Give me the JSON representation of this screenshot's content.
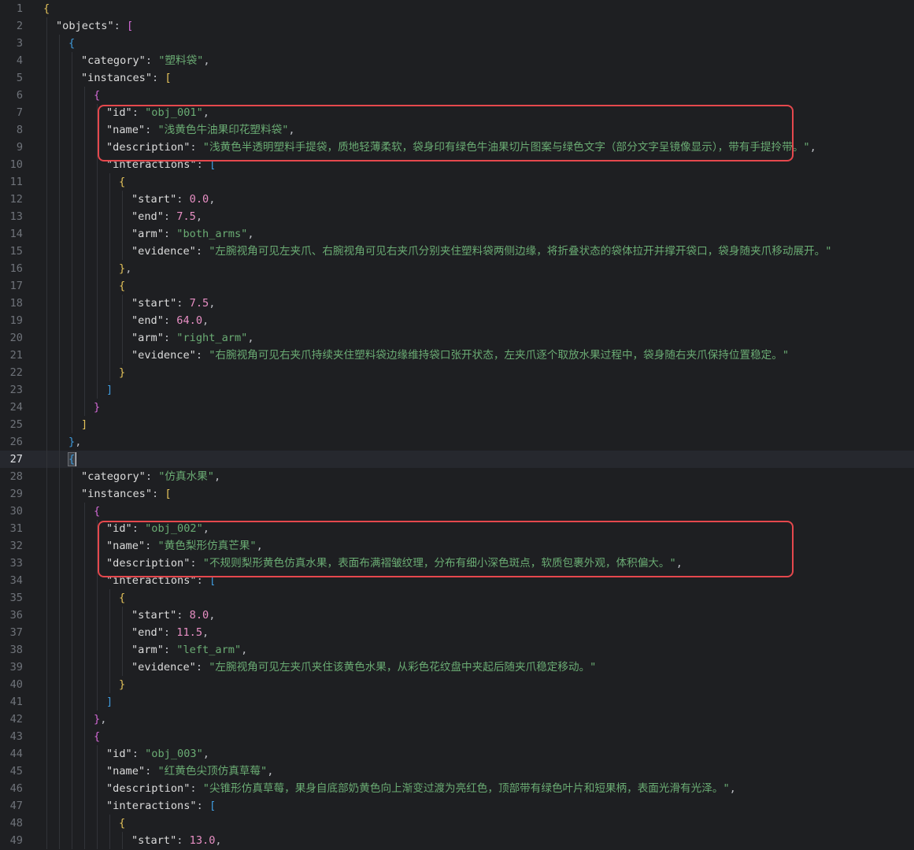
{
  "editor": {
    "current_line": 27,
    "highlight_boxes": [
      {
        "name": "highlight-obj-001",
        "from_line": 7,
        "to_line": 9
      },
      {
        "name": "highlight-obj-002",
        "from_line": 31,
        "to_line": 33
      }
    ],
    "lines": [
      {
        "n": "1",
        "indent": 0,
        "t": [
          [
            "b1",
            "{"
          ]
        ]
      },
      {
        "n": "2",
        "indent": 1,
        "t": [
          [
            "key",
            "\"objects\""
          ],
          [
            "punc",
            ": "
          ],
          [
            "b2",
            "["
          ]
        ]
      },
      {
        "n": "3",
        "indent": 2,
        "t": [
          [
            "b3",
            "{"
          ]
        ]
      },
      {
        "n": "4",
        "indent": 3,
        "t": [
          [
            "key",
            "\"category\""
          ],
          [
            "punc",
            ": "
          ],
          [
            "str",
            "\"塑料袋\""
          ],
          [
            "punc",
            ","
          ]
        ]
      },
      {
        "n": "5",
        "indent": 3,
        "t": [
          [
            "key",
            "\"instances\""
          ],
          [
            "punc",
            ": "
          ],
          [
            "b1",
            "["
          ]
        ]
      },
      {
        "n": "6",
        "indent": 4,
        "t": [
          [
            "b2",
            "{"
          ]
        ]
      },
      {
        "n": "7",
        "indent": 5,
        "t": [
          [
            "key",
            "\"id\""
          ],
          [
            "punc",
            ": "
          ],
          [
            "str",
            "\"obj_001\""
          ],
          [
            "punc",
            ","
          ]
        ]
      },
      {
        "n": "8",
        "indent": 5,
        "t": [
          [
            "key",
            "\"name\""
          ],
          [
            "punc",
            ": "
          ],
          [
            "str",
            "\"浅黄色牛油果印花塑料袋\""
          ],
          [
            "punc",
            ","
          ]
        ]
      },
      {
        "n": "9",
        "indent": 5,
        "t": [
          [
            "key",
            "\"description\""
          ],
          [
            "punc",
            ": "
          ],
          [
            "str",
            "\"浅黄色半透明塑料手提袋，质地轻薄柔软，袋身印有绿色牛油果切片图案与绿色文字（部分文字呈镜像显示），带有手提拎带。\""
          ],
          [
            "punc",
            ","
          ]
        ]
      },
      {
        "n": "10",
        "indent": 5,
        "t": [
          [
            "key",
            "\"interactions\""
          ],
          [
            "punc",
            ": "
          ],
          [
            "b3",
            "["
          ]
        ]
      },
      {
        "n": "11",
        "indent": 6,
        "t": [
          [
            "b1",
            "{"
          ]
        ]
      },
      {
        "n": "12",
        "indent": 7,
        "t": [
          [
            "key",
            "\"start\""
          ],
          [
            "punc",
            ": "
          ],
          [
            "num",
            "0.0"
          ],
          [
            "punc",
            ","
          ]
        ]
      },
      {
        "n": "13",
        "indent": 7,
        "t": [
          [
            "key",
            "\"end\""
          ],
          [
            "punc",
            ": "
          ],
          [
            "num",
            "7.5"
          ],
          [
            "punc",
            ","
          ]
        ]
      },
      {
        "n": "14",
        "indent": 7,
        "t": [
          [
            "key",
            "\"arm\""
          ],
          [
            "punc",
            ": "
          ],
          [
            "str",
            "\"both_arms\""
          ],
          [
            "punc",
            ","
          ]
        ]
      },
      {
        "n": "15",
        "indent": 7,
        "t": [
          [
            "key",
            "\"evidence\""
          ],
          [
            "punc",
            ": "
          ],
          [
            "str",
            "\"左腕视角可见左夹爪、右腕视角可见右夹爪分别夹住塑料袋两侧边缘，将折叠状态的袋体拉开并撑开袋口，袋身随夹爪移动展开。\""
          ]
        ]
      },
      {
        "n": "16",
        "indent": 6,
        "t": [
          [
            "b1",
            "}"
          ],
          [
            "punc",
            ","
          ]
        ]
      },
      {
        "n": "17",
        "indent": 6,
        "t": [
          [
            "b1",
            "{"
          ]
        ]
      },
      {
        "n": "18",
        "indent": 7,
        "t": [
          [
            "key",
            "\"start\""
          ],
          [
            "punc",
            ": "
          ],
          [
            "num",
            "7.5"
          ],
          [
            "punc",
            ","
          ]
        ]
      },
      {
        "n": "19",
        "indent": 7,
        "t": [
          [
            "key",
            "\"end\""
          ],
          [
            "punc",
            ": "
          ],
          [
            "num",
            "64.0"
          ],
          [
            "punc",
            ","
          ]
        ]
      },
      {
        "n": "20",
        "indent": 7,
        "t": [
          [
            "key",
            "\"arm\""
          ],
          [
            "punc",
            ": "
          ],
          [
            "str",
            "\"right_arm\""
          ],
          [
            "punc",
            ","
          ]
        ]
      },
      {
        "n": "21",
        "indent": 7,
        "t": [
          [
            "key",
            "\"evidence\""
          ],
          [
            "punc",
            ": "
          ],
          [
            "str",
            "\"右腕视角可见右夹爪持续夹住塑料袋边缘维持袋口张开状态，左夹爪逐个取放水果过程中，袋身随右夹爪保持位置稳定。\""
          ]
        ]
      },
      {
        "n": "22",
        "indent": 6,
        "t": [
          [
            "b1",
            "}"
          ]
        ]
      },
      {
        "n": "23",
        "indent": 5,
        "t": [
          [
            "b3",
            "]"
          ]
        ]
      },
      {
        "n": "24",
        "indent": 4,
        "t": [
          [
            "b2",
            "}"
          ]
        ]
      },
      {
        "n": "25",
        "indent": 3,
        "t": [
          [
            "b1",
            "]"
          ]
        ]
      },
      {
        "n": "26",
        "indent": 2,
        "t": [
          [
            "b3",
            "}"
          ],
          [
            "punc",
            ","
          ]
        ]
      },
      {
        "n": "27",
        "indent": 2,
        "t": [
          [
            "b3 cursor-bracket",
            "{"
          ],
          [
            "caret",
            ""
          ]
        ]
      },
      {
        "n": "28",
        "indent": 3,
        "t": [
          [
            "key",
            "\"category\""
          ],
          [
            "punc",
            ": "
          ],
          [
            "str",
            "\"仿真水果\""
          ],
          [
            "punc",
            ","
          ]
        ]
      },
      {
        "n": "29",
        "indent": 3,
        "t": [
          [
            "key",
            "\"instances\""
          ],
          [
            "punc",
            ": "
          ],
          [
            "b1",
            "["
          ]
        ]
      },
      {
        "n": "30",
        "indent": 4,
        "t": [
          [
            "b2",
            "{"
          ]
        ]
      },
      {
        "n": "31",
        "indent": 5,
        "t": [
          [
            "key",
            "\"id\""
          ],
          [
            "punc",
            ": "
          ],
          [
            "str",
            "\"obj_002\""
          ],
          [
            "punc",
            ","
          ]
        ]
      },
      {
        "n": "32",
        "indent": 5,
        "t": [
          [
            "key",
            "\"name\""
          ],
          [
            "punc",
            ": "
          ],
          [
            "str",
            "\"黄色梨形仿真芒果\""
          ],
          [
            "punc",
            ","
          ]
        ]
      },
      {
        "n": "33",
        "indent": 5,
        "t": [
          [
            "key",
            "\"description\""
          ],
          [
            "punc",
            ": "
          ],
          [
            "str",
            "\"不规则梨形黄色仿真水果，表面布满褶皱纹理，分布有细小深色斑点，软质包裹外观，体积偏大。\""
          ],
          [
            "punc",
            ","
          ]
        ]
      },
      {
        "n": "34",
        "indent": 5,
        "t": [
          [
            "key",
            "\"interactions\""
          ],
          [
            "punc",
            ": "
          ],
          [
            "b3",
            "["
          ]
        ]
      },
      {
        "n": "35",
        "indent": 6,
        "t": [
          [
            "b1",
            "{"
          ]
        ]
      },
      {
        "n": "36",
        "indent": 7,
        "t": [
          [
            "key",
            "\"start\""
          ],
          [
            "punc",
            ": "
          ],
          [
            "num",
            "8.0"
          ],
          [
            "punc",
            ","
          ]
        ]
      },
      {
        "n": "37",
        "indent": 7,
        "t": [
          [
            "key",
            "\"end\""
          ],
          [
            "punc",
            ": "
          ],
          [
            "num",
            "11.5"
          ],
          [
            "punc",
            ","
          ]
        ]
      },
      {
        "n": "38",
        "indent": 7,
        "t": [
          [
            "key",
            "\"arm\""
          ],
          [
            "punc",
            ": "
          ],
          [
            "str",
            "\"left_arm\""
          ],
          [
            "punc",
            ","
          ]
        ]
      },
      {
        "n": "39",
        "indent": 7,
        "t": [
          [
            "key",
            "\"evidence\""
          ],
          [
            "punc",
            ": "
          ],
          [
            "str",
            "\"左腕视角可见左夹爪夹住该黄色水果，从彩色花纹盘中夹起后随夹爪稳定移动。\""
          ]
        ]
      },
      {
        "n": "40",
        "indent": 6,
        "t": [
          [
            "b1",
            "}"
          ]
        ]
      },
      {
        "n": "41",
        "indent": 5,
        "t": [
          [
            "b3",
            "]"
          ]
        ]
      },
      {
        "n": "42",
        "indent": 4,
        "t": [
          [
            "b2",
            "}"
          ],
          [
            "punc",
            ","
          ]
        ]
      },
      {
        "n": "43",
        "indent": 4,
        "t": [
          [
            "b2",
            "{"
          ]
        ]
      },
      {
        "n": "44",
        "indent": 5,
        "t": [
          [
            "key",
            "\"id\""
          ],
          [
            "punc",
            ": "
          ],
          [
            "str",
            "\"obj_003\""
          ],
          [
            "punc",
            ","
          ]
        ]
      },
      {
        "n": "45",
        "indent": 5,
        "t": [
          [
            "key",
            "\"name\""
          ],
          [
            "punc",
            ": "
          ],
          [
            "str",
            "\"红黄色尖顶仿真草莓\""
          ],
          [
            "punc",
            ","
          ]
        ]
      },
      {
        "n": "46",
        "indent": 5,
        "t": [
          [
            "key",
            "\"description\""
          ],
          [
            "punc",
            ": "
          ],
          [
            "str",
            "\"尖锥形仿真草莓，果身自底部奶黄色向上渐变过渡为亮红色，顶部带有绿色叶片和短果柄，表面光滑有光泽。\""
          ],
          [
            "punc",
            ","
          ]
        ]
      },
      {
        "n": "47",
        "indent": 5,
        "t": [
          [
            "key",
            "\"interactions\""
          ],
          [
            "punc",
            ": "
          ],
          [
            "b3",
            "["
          ]
        ]
      },
      {
        "n": "48",
        "indent": 6,
        "t": [
          [
            "b1",
            "{"
          ]
        ]
      },
      {
        "n": "49",
        "indent": 7,
        "t": [
          [
            "key",
            "\"start\""
          ],
          [
            "punc",
            ": "
          ],
          [
            "num",
            "13.0"
          ],
          [
            "punc",
            ","
          ]
        ]
      }
    ]
  }
}
